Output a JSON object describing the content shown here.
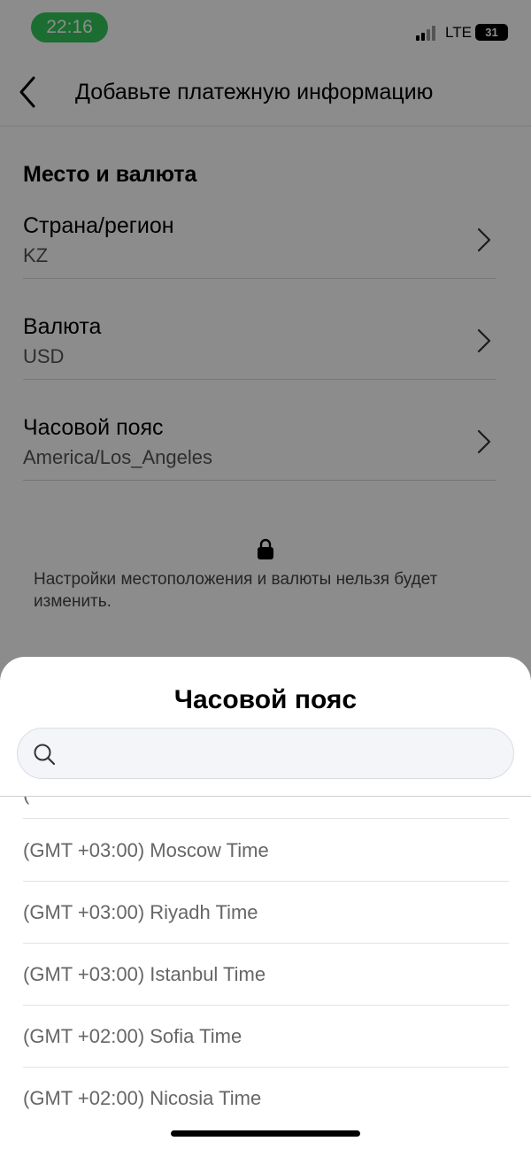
{
  "status_bar": {
    "time": "22:16",
    "network": "LTE",
    "battery": "31"
  },
  "header": {
    "title": "Добавьте платежную информацию"
  },
  "section": {
    "title": "Место и валюта",
    "rows": [
      {
        "label": "Страна/регион",
        "value": "KZ"
      },
      {
        "label": "Валюта",
        "value": "USD"
      },
      {
        "label": "Часовой пояс",
        "value": "America/Los_Angeles"
      }
    ],
    "note": "Настройки местоположения и валюты нельзя будет изменить."
  },
  "sheet": {
    "title": "Часовой пояс",
    "search": {
      "placeholder": ""
    },
    "items": [
      "(GMT +03:00) Moscow Time",
      "(GMT +03:00) Riyadh Time",
      "(GMT +03:00) Istanbul Time",
      "(GMT +02:00) Sofia Time",
      "(GMT +02:00) Nicosia Time"
    ]
  }
}
